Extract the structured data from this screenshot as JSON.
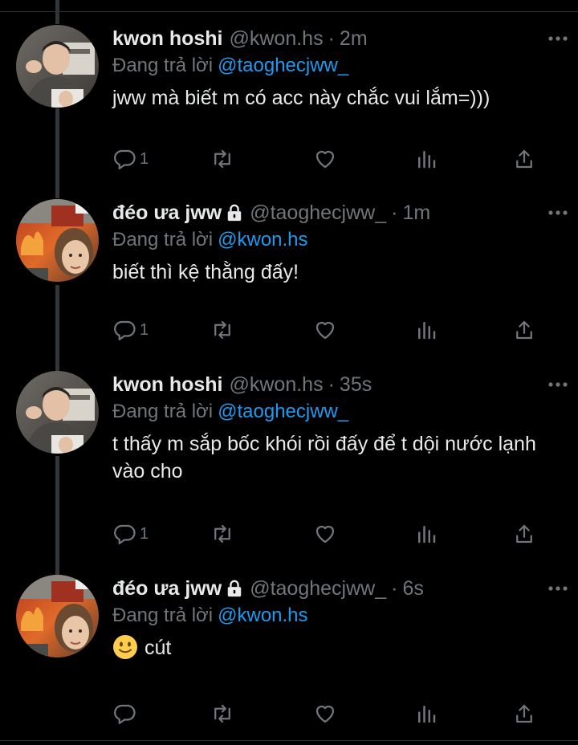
{
  "colors": {
    "background": "#000000",
    "text": "#e7e9ea",
    "muted": "#71767b",
    "accent": "#1d9bf0",
    "thread_line": "#333639"
  },
  "tweets": [
    {
      "display_name": "kwon hoshi",
      "handle": "@kwon.hs",
      "time": "2m",
      "locked": false,
      "reply_prefix": "Đang trả lời",
      "reply_to": "@taoghecjww_",
      "text": "jww mà biết m có acc này chắc vui lắm=)))",
      "reply_count": "1",
      "avatar": "boy-avatar"
    },
    {
      "display_name": "đéo ưa jww",
      "handle": "@taoghecjww_",
      "time": "1m",
      "locked": true,
      "reply_prefix": "Đang trả lời",
      "reply_to": "@kwon.hs",
      "text": "biết thì kệ thằng đấy!",
      "reply_count": "1",
      "avatar": "girl-fire-avatar"
    },
    {
      "display_name": "kwon hoshi",
      "handle": "@kwon.hs",
      "time": "35s",
      "locked": false,
      "reply_prefix": "Đang trả lời",
      "reply_to": "@taoghecjww_",
      "text": "t thấy m sắp bốc khói rồi đấy để t dội nước lạnh vào cho",
      "reply_count": "1",
      "avatar": "boy-avatar"
    },
    {
      "display_name": "đéo ưa jww",
      "handle": "@taoghecjww_",
      "time": "6s",
      "locked": true,
      "reply_prefix": "Đang trả lời",
      "reply_to": "@kwon.hs",
      "text": "cút",
      "emoji": "slightly-smiling-face",
      "reply_count": "",
      "avatar": "girl-fire-avatar"
    }
  ],
  "separator": "·"
}
